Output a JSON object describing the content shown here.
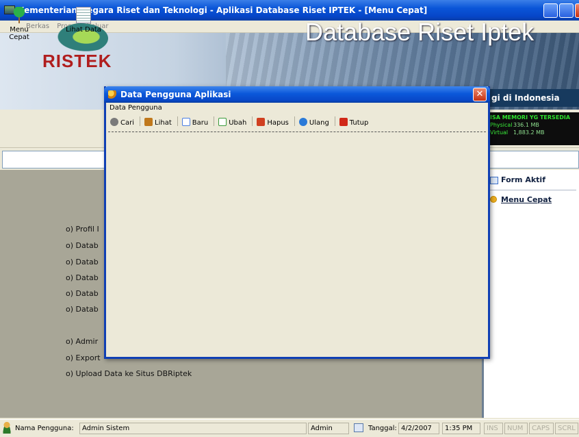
{
  "window": {
    "title": "Kementerian Negara Riset dan Teknologi - Aplikasi Database Riset IPTEK - [Menu Cepat]",
    "menu": [
      "Berkas",
      "Proses",
      "Keluar"
    ],
    "menu_icon": "app-icon"
  },
  "banner": {
    "logo_text": "RISTEK",
    "title": "Database Riset Iptek",
    "subtitle": "gi di Indonesia"
  },
  "toolbar": {
    "items": [
      {
        "label": "Menu Cepat",
        "icon": "signpost-icon"
      },
      {
        "label": "Lihat Data",
        "icon": "document-icon"
      }
    ]
  },
  "memory": {
    "heading": "ISA MEMORI YG TERSEDIA",
    "physical_label": "Physical",
    "physical_value": "336.1 MB",
    "virtual_label": "Virtual",
    "virtual_value": "1,883.2 MB"
  },
  "main": {
    "links": [
      "o)  Profil I",
      "o)  Datab",
      "o)  Datab",
      "o)  Datab",
      "o)  Datab",
      "o)  Datab",
      "o)  Admir",
      "o)  Export",
      "o)  Upload  Data ke Situs DBRiptek"
    ]
  },
  "right_panel": {
    "form_aktif": "Form Aktif",
    "menu_cepat": "Menu Cepat"
  },
  "dialog": {
    "title": "Data Pengguna Aplikasi",
    "header": "Data Pengguna",
    "close_symbol": "✕",
    "tools": [
      {
        "label": "Cari",
        "icon": "binoculars-icon",
        "color": "#7a7a7a"
      },
      {
        "label": "Lihat",
        "icon": "users-icon",
        "color": "#c0781c"
      },
      {
        "label": "Baru",
        "icon": "new-document-icon",
        "color": "#4a7ee0"
      },
      {
        "label": "Ubah",
        "icon": "edit-icon",
        "color": "#3a9a3a"
      },
      {
        "label": "Hapus",
        "icon": "delete-icon",
        "color": "#d04020"
      },
      {
        "label": "Ulang",
        "icon": "refresh-icon",
        "color": "#2a7ad8"
      },
      {
        "label": "Tutup",
        "icon": "close-icon",
        "color": "#d02818"
      }
    ]
  },
  "status": {
    "user_label": "Nama Pengguna:",
    "user_value": "Admin Sistem",
    "role": "Admin",
    "date_label": "Tanggal:",
    "date_value": "4/2/2007",
    "time": "1:35 PM",
    "indicators": [
      "INS",
      "NUM",
      "CAPS",
      "SCRL"
    ]
  },
  "colors": {
    "title_blue": "#0a55d8",
    "main_panel": "#a8a697",
    "memory_text": "#19d019"
  }
}
